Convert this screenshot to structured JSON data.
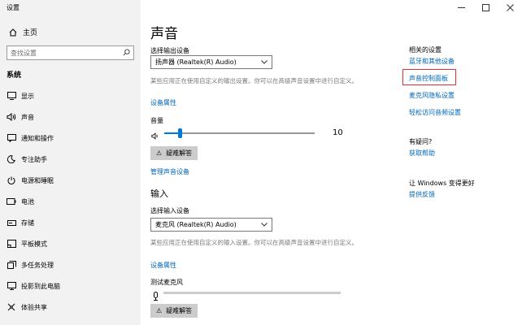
{
  "window": {
    "title": "设置"
  },
  "sidebar": {
    "home": "主页",
    "search_placeholder": "查找设置",
    "section": "系统",
    "items": [
      {
        "label": "显示",
        "icon": "display-icon"
      },
      {
        "label": "声音",
        "icon": "speaker-icon"
      },
      {
        "label": "通知和操作",
        "icon": "notification-icon"
      },
      {
        "label": "专注助手",
        "icon": "moon-icon"
      },
      {
        "label": "电源和睡眠",
        "icon": "power-icon"
      },
      {
        "label": "电池",
        "icon": "battery-icon"
      },
      {
        "label": "存储",
        "icon": "storage-icon"
      },
      {
        "label": "平板模式",
        "icon": "tablet-icon"
      },
      {
        "label": "多任务处理",
        "icon": "multitask-icon"
      },
      {
        "label": "投影到此电脑",
        "icon": "project-icon"
      },
      {
        "label": "体验共享",
        "icon": "share-icon"
      }
    ]
  },
  "main": {
    "title": "声音",
    "output": {
      "label": "选择输出设备",
      "device": "扬声器 (Realtek(R) Audio)",
      "desc": "某些应用正在使用自定义的输出设置。你可以在高级声音设置中进行自定义。",
      "props_link": "设备属性",
      "volume_label": "音量",
      "volume_value": "10",
      "troubleshoot": "疑难解答",
      "manage_link": "管理声音设备"
    },
    "input": {
      "heading": "输入",
      "label": "选择输入设备",
      "device": "麦克风 (Realtek(R) Audio)",
      "desc": "某些应用正在使用自定义的输入设置。你可以在高级声音设置中进行自定义。",
      "props_link": "设备属性",
      "test_label": "测试麦克风",
      "troubleshoot": "疑难解答"
    }
  },
  "right": {
    "related_heading": "相关的设置",
    "related_links": [
      "蓝牙和其他设备",
      "声音控制面板",
      "麦克风隐私设置",
      "轻松访问音频设置"
    ],
    "help_heading": "有疑问?",
    "help_link": "获取帮助",
    "better_heading": "让 Windows 变得更好",
    "feedback_link": "提供反馈"
  },
  "colors": {
    "accent": "#0078d7",
    "link": "#0067b8",
    "highlight": "#e03030"
  }
}
